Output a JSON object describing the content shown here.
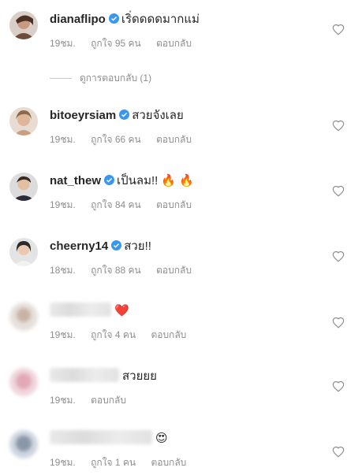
{
  "comments": [
    {
      "username": "dianaflipo",
      "verified": true,
      "text": "เริ่ดดดดมากแม่",
      "emoji": "",
      "time": "19ชม.",
      "likes": "ถูกใจ 95 คน",
      "reply": "ตอบกลับ",
      "blurred": false
    },
    {
      "username": "bitoeyrsiam",
      "verified": true,
      "text": "สวยจังเลย",
      "emoji": "",
      "time": "19ชม.",
      "likes": "ถูกใจ 66 คน",
      "reply": "ตอบกลับ",
      "blurred": false
    },
    {
      "username": "nat_thew",
      "verified": true,
      "text": "เป็นลม!!",
      "emoji": "🔥 🔥",
      "time": "19ชม.",
      "likes": "ถูกใจ 84 คน",
      "reply": "ตอบกลับ",
      "blurred": false
    },
    {
      "username": "cheerny14",
      "verified": true,
      "text": "สวย!!",
      "emoji": "",
      "time": "18ชม.",
      "likes": "ถูกใจ 88 คน",
      "reply": "ตอบกลับ",
      "blurred": false
    },
    {
      "username": "",
      "verified": false,
      "text": "",
      "emoji": "❤️",
      "time": "19ชม.",
      "likes": "ถูกใจ 4 คน",
      "reply": "ตอบกลับ",
      "blurred": true
    },
    {
      "username": "",
      "verified": false,
      "text": "สวยยย",
      "emoji": "",
      "time": "19ชม.",
      "likes": "",
      "reply": "ตอบกลับ",
      "blurred": true
    },
    {
      "username": "",
      "verified": false,
      "text": "",
      "emoji": "😍",
      "time": "19ชม.",
      "likes": "ถูกใจ 1 คน",
      "reply": "ตอบกลับ",
      "blurred": true
    }
  ],
  "view_replies": "ดูการตอบกลับ (1)",
  "colors": {
    "text": "#262626",
    "meta": "#8e8e8e",
    "verified": "#3897f0",
    "heart_outline": "#8e8e8e"
  },
  "icons": {
    "verified": "verified-badge-icon",
    "like": "heart-outline-icon"
  }
}
